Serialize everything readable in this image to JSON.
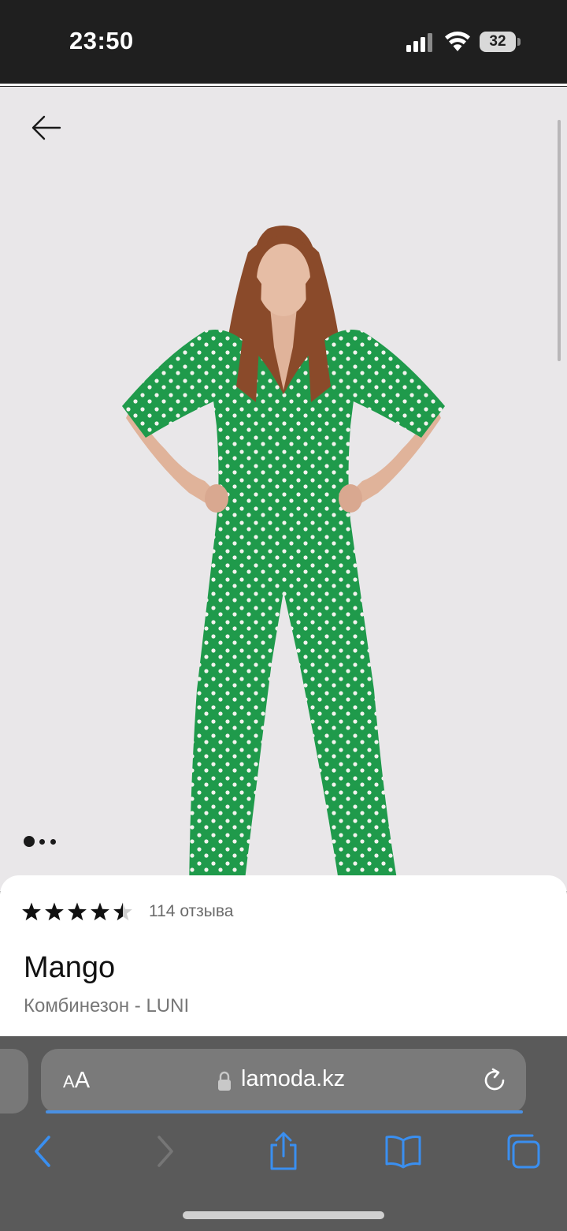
{
  "status_bar": {
    "time": "23:50",
    "battery_level": "32"
  },
  "product": {
    "image_count": 3,
    "active_image_index": 0,
    "rating": 4.5,
    "rating_max": 5,
    "reviews_text": "114 отзыва",
    "brand": "Mango",
    "name": "Комбинезон - LUNI"
  },
  "browser": {
    "url": "lamoda.kz",
    "text_size_label_small": "A",
    "text_size_label_big": "A",
    "accent_color": "#4a90e2",
    "load_progress": 1.0
  },
  "icons": {
    "back": "back-arrow-icon",
    "lock": "lock-icon",
    "reload": "reload-icon",
    "share": "share-icon",
    "bookmarks": "book-icon",
    "tabs": "tabs-icon"
  },
  "colors": {
    "jumpsuit": "#1f9a4b",
    "background": "#e9e7e9",
    "toolbar": "#5a5a5a"
  }
}
